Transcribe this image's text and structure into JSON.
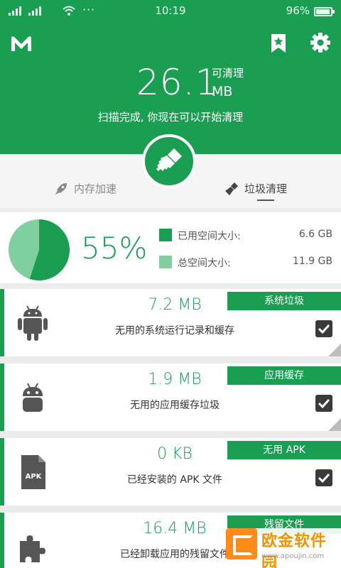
{
  "status_bar": {
    "time": "10:19",
    "battery": "96%",
    "battery_level": 0.96
  },
  "header": {
    "cleanable_size": "26.1",
    "cleanable_label": "可清理",
    "unit": "MB",
    "scan_message": "扫描完成, 你现在可以开始清理"
  },
  "tabs": [
    {
      "label": "内存加速",
      "icon": "rocket-icon",
      "active": false
    },
    {
      "label": "垃圾清理",
      "icon": "broom-icon",
      "active": true
    }
  ],
  "storage": {
    "percent": "55%",
    "used_fraction": 0.55,
    "used_label": "已用空间大小:",
    "used_value": "6.6 GB",
    "total_label": "总空间大小:",
    "total_value": "11.9 GB",
    "used_color": "#1a9e52",
    "total_color": "#7fcf9f"
  },
  "items": [
    {
      "tag": "系统垃圾",
      "size": "7.2 MB",
      "desc": "无用的系统运行记录和缓存",
      "icon": "android-icon",
      "checked": true
    },
    {
      "tag": "应用缓存",
      "size": "1.9 MB",
      "desc": "无用的应用缓存垃圾",
      "icon": "android-head-icon",
      "checked": true
    },
    {
      "tag": "无用 APK",
      "size": "0 KB",
      "desc": "已经安装的 APK 文件",
      "icon": "apk-file-icon",
      "icon_text": "APK",
      "checked": true
    },
    {
      "tag": "残留文件",
      "size": "16.4 MB",
      "desc": "已经卸载应用的残留文件",
      "icon": "puzzle-icon",
      "checked": true
    }
  ],
  "watermark": {
    "text": "欧金软件园",
    "url": "www.apoujin.com"
  },
  "colors": {
    "accent": "#1a9e52",
    "background": "#ececec"
  }
}
